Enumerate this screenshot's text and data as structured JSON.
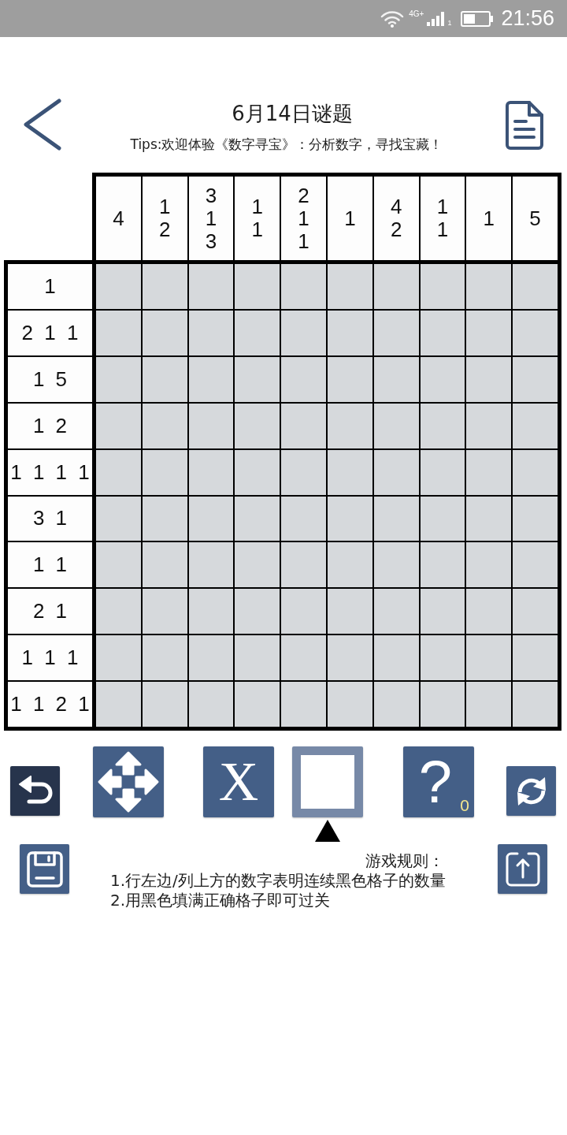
{
  "status_bar": {
    "network": "4G+",
    "sim": "1",
    "time": "21:56"
  },
  "header": {
    "title": "6月14日谜题",
    "tips": "Tips:欢迎体验《数字寻宝》：分析数字，寻找宝藏！"
  },
  "puzzle": {
    "column_clues": [
      "4",
      "1\n2",
      "3\n1\n3",
      "1\n1",
      "2\n1\n1",
      "1",
      "4\n2",
      "1\n1",
      "1",
      "5"
    ],
    "row_clues": [
      "1",
      "2 1 1",
      "1 5",
      "1 2",
      "1 1 1 1",
      "3 1",
      "1 1",
      "2 1",
      "1 1 1",
      "1 1 2 1"
    ]
  },
  "tools": [
    {
      "kind": "undo",
      "selected": false
    },
    {
      "kind": "move",
      "selected": false
    },
    {
      "kind": "cross",
      "label": "X",
      "selected": false
    },
    {
      "kind": "fill",
      "selected": true
    },
    {
      "kind": "hint",
      "label": "?",
      "count": "0",
      "selected": false
    },
    {
      "kind": "restart",
      "selected": false
    }
  ],
  "rules": {
    "heading": "游戏规则：",
    "lines": [
      "1.行左边/列上方的数字表明连续黑色格子的数量",
      "2.用黑色填满正确格子即可过关"
    ]
  }
}
